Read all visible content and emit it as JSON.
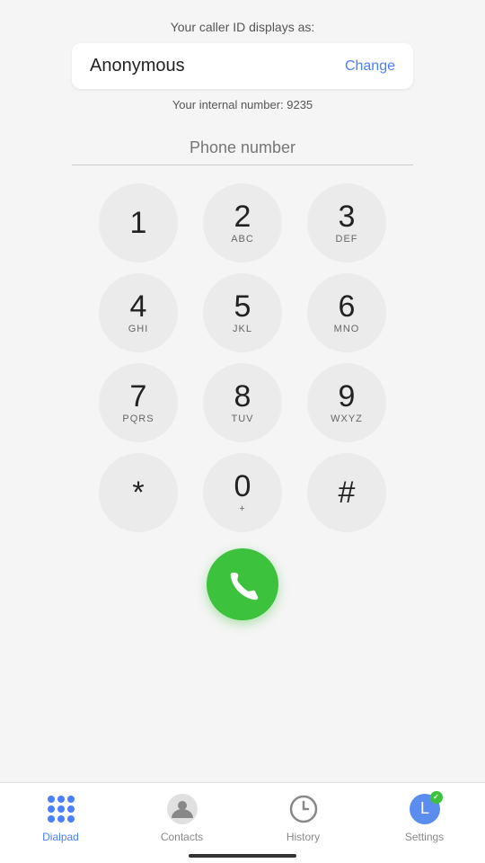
{
  "header": {
    "caller_id_label": "Your caller ID displays as:",
    "caller_name": "Anonymous",
    "change_btn": "Change",
    "internal_number_label": "Your internal number: 9235"
  },
  "phone_input": {
    "placeholder": "Phone number"
  },
  "dialpad": {
    "rows": [
      [
        {
          "main": "1",
          "sub": ""
        },
        {
          "main": "2",
          "sub": "ABC"
        },
        {
          "main": "3",
          "sub": "DEF"
        }
      ],
      [
        {
          "main": "4",
          "sub": "GHI"
        },
        {
          "main": "5",
          "sub": "JKL"
        },
        {
          "main": "6",
          "sub": "MNO"
        }
      ],
      [
        {
          "main": "7",
          "sub": "PQRS"
        },
        {
          "main": "8",
          "sub": "TUV"
        },
        {
          "main": "9",
          "sub": "WXYZ"
        }
      ],
      [
        {
          "main": "*",
          "sub": ""
        },
        {
          "main": "0",
          "sub": "+"
        },
        {
          "main": "#",
          "sub": ""
        }
      ]
    ]
  },
  "bottom_nav": {
    "items": [
      {
        "label": "Dialpad",
        "active": true,
        "name": "dialpad"
      },
      {
        "label": "Contacts",
        "active": false,
        "name": "contacts"
      },
      {
        "label": "History",
        "active": false,
        "name": "history"
      },
      {
        "label": "Settings",
        "active": false,
        "name": "settings"
      }
    ]
  },
  "colors": {
    "active_blue": "#4a7fff",
    "call_green": "#3cc23c",
    "inactive_gray": "#888888"
  }
}
